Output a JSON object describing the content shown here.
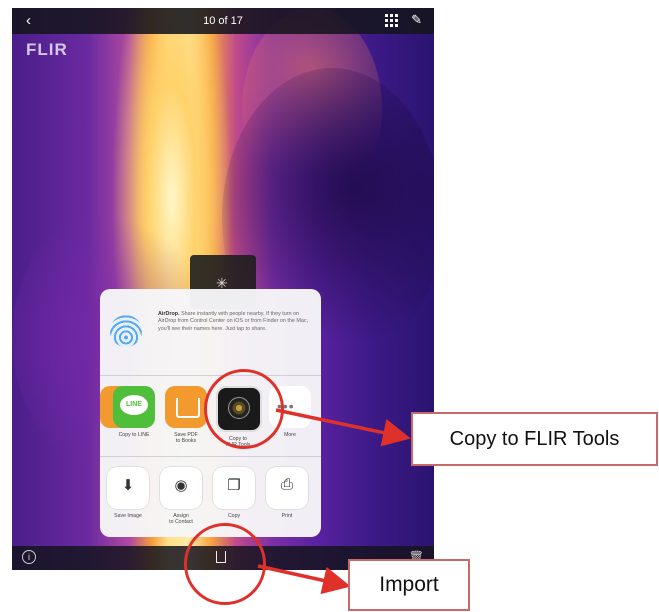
{
  "topbar": {
    "back_glyph": "‹",
    "title": "10 of 17",
    "grid_icon": "grid-icon",
    "edit_icon": "pencil-icon",
    "edit_glyph": "✎"
  },
  "image": {
    "logo": "FLIR"
  },
  "spinner_glyph": "✳",
  "share_sheet": {
    "airdrop": {
      "title": "AirDrop.",
      "text": "Share instantly with people nearby. If they turn on AirDrop from Control Center on iOS or from Finder on the Mac, you'll see their names here. Just tap to share."
    },
    "apps": [
      {
        "label": "Copy to LINE",
        "icon": "line-icon",
        "glyph": "LINE"
      },
      {
        "label": "Save PDF\nto Books",
        "icon": "books-icon"
      },
      {
        "label": "Copy to\nFLIR Tools",
        "icon": "flir-tools-icon"
      },
      {
        "label": "More",
        "icon": "more-icon",
        "glyph": "•••"
      }
    ],
    "actions": [
      {
        "label": "Save Image",
        "icon": "save-image-icon",
        "glyph": "⬇"
      },
      {
        "label": "Assign\nto Contact",
        "icon": "contact-icon",
        "glyph": "◉"
      },
      {
        "label": "Copy",
        "icon": "copy-icon",
        "glyph": "❐"
      },
      {
        "label": "Print",
        "icon": "print-icon",
        "glyph": "⎙"
      }
    ]
  },
  "bottombar": {
    "info_glyph": "i",
    "share_icon": "share-icon",
    "trash_icon": "trash-icon",
    "trash_glyph": "🗑"
  },
  "annotations": {
    "copy_label": "Copy to FLIR Tools",
    "import_label": "Import"
  },
  "colors": {
    "annotation_red": "#e0302a",
    "line_green": "#4fbe3a",
    "books_orange": "#f29a2e"
  }
}
